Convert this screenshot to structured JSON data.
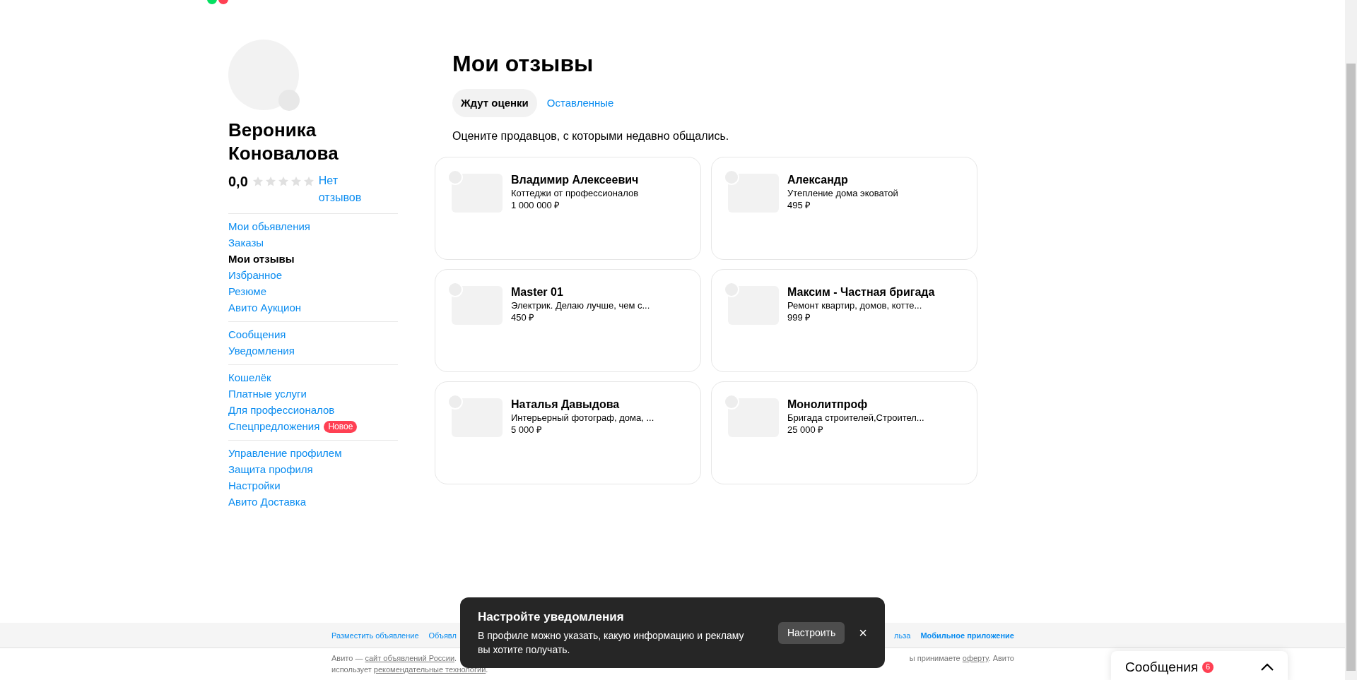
{
  "profile": {
    "name": "Вероника Коновалова",
    "rating": "0,0",
    "stars": 0,
    "reviews_link": "Нет отзывов"
  },
  "menu_groups": [
    [
      {
        "label": "Мои обьявления",
        "selected": false
      },
      {
        "label": "Заказы",
        "selected": false
      },
      {
        "label": "Мои отзывы",
        "selected": true
      },
      {
        "label": "Избранное",
        "selected": false
      },
      {
        "label": "Резюме",
        "selected": false
      },
      {
        "label": "Авито Аукцион",
        "selected": false
      }
    ],
    [
      {
        "label": "Сообщения",
        "selected": false
      },
      {
        "label": "Уведомления",
        "selected": false
      }
    ],
    [
      {
        "label": "Кошелёк",
        "selected": false
      },
      {
        "label": "Платные услуги",
        "selected": false
      },
      {
        "label": "Для профессионалов",
        "selected": false
      },
      {
        "label": "Спецпредложения",
        "selected": false,
        "badge": "Новое"
      }
    ],
    [
      {
        "label": "Управление профилем",
        "selected": false
      },
      {
        "label": "Защита профиля",
        "selected": false
      },
      {
        "label": "Настройки",
        "selected": false
      },
      {
        "label": "Авито Доставка",
        "selected": false
      }
    ]
  ],
  "page_title": "Мои отзывы",
  "tabs": [
    {
      "label": "Ждут оценки",
      "selected": true
    },
    {
      "label": "Оставленные",
      "selected": false
    }
  ],
  "hint": "Оцените продавцов, с которыми недавно общались.",
  "sellers": [
    {
      "name": "Владимир Алексеевич",
      "description": "Коттеджи от профессионалов",
      "price": "1 000 000 ₽"
    },
    {
      "name": "Александр",
      "description": "Утепление дома эковатой",
      "price": "495 ₽"
    },
    {
      "name": "Master 01",
      "description": "Электрик. Делаю лучше, чем с...",
      "price": "450 ₽"
    },
    {
      "name": "Максим - Частная бригада",
      "description": "Ремонт квартир, домов, котте...",
      "price": "999 ₽"
    },
    {
      "name": "Наталья Давыдова",
      "description": "Интерьерный фотограф, дома, ...",
      "price": "5 000 ₽"
    },
    {
      "name": "Монолитпроф",
      "description": "Бригада строителей,Строител...",
      "price": "25 000 ₽"
    }
  ],
  "footer": {
    "links_left": [
      "Разместить объявление",
      "Объявл"
    ],
    "links_right": [
      "льза"
    ],
    "app_link": "Мобильное приложение",
    "legal_left": "Авито — ",
    "legal_left_link": "сайт объявлений России",
    "legal_left_end": ".",
    "legal_right": "ы принимаете ",
    "legal_right_link": "оферту",
    "legal_right_end": ". Авито",
    "legal_line2": "использует ",
    "legal_line2_link": "рекомендательные технологии",
    "legal_line2_end": "."
  },
  "toast": {
    "title": "Настройте уведомления",
    "text": "В профиле можно указать, какую информацию и рекламу вы хотите получать.",
    "button": "Настроить",
    "close": "×"
  },
  "messages_widget": {
    "label": "Сообщения",
    "count": "6"
  }
}
